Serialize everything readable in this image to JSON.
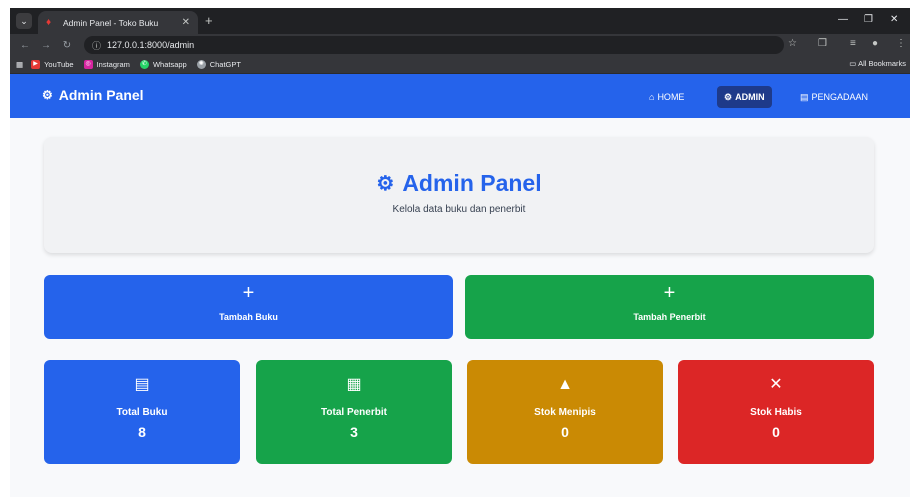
{
  "browser": {
    "tab_title": "Admin Panel - Toko Buku",
    "url": "127.0.0.1:8000/admin",
    "bookmarks": [
      {
        "label": "YouTube",
        "color": "#e53935"
      },
      {
        "label": "Instagram",
        "color": "#d6249f"
      },
      {
        "label": "Whatsapp",
        "color": "#25d366"
      },
      {
        "label": "ChatGPT",
        "color": "#9aa0a6"
      }
    ],
    "all_bookmarks": "All Bookmarks"
  },
  "navbar": {
    "brand": "Admin Panel",
    "brand_icon": "gears-icon",
    "links": [
      {
        "label": "HOME",
        "icon": "home-icon",
        "active": false
      },
      {
        "label": "ADMIN",
        "icon": "gear-icon",
        "active": true
      },
      {
        "label": "PENGADAAN",
        "icon": "clipboard-icon",
        "active": false
      }
    ]
  },
  "hero": {
    "title": "Admin Panel",
    "subtitle": "Kelola data buku dan penerbit"
  },
  "actions": [
    {
      "label": "Tambah Buku",
      "icon": "plus-icon",
      "color": "#2563eb"
    },
    {
      "label": "Tambah Penerbit",
      "icon": "plus-icon",
      "color": "#16a34a"
    }
  ],
  "stats": [
    {
      "label": "Total Buku",
      "value": "8",
      "icon": "book-icon",
      "color": "#2563eb"
    },
    {
      "label": "Total Penerbit",
      "value": "3",
      "icon": "building-icon",
      "color": "#16a34a"
    },
    {
      "label": "Stok Menipis",
      "value": "0",
      "icon": "warning-icon",
      "color": "#ca8a04"
    },
    {
      "label": "Stok Habis",
      "value": "0",
      "icon": "x-icon",
      "color": "#dc2626"
    }
  ]
}
